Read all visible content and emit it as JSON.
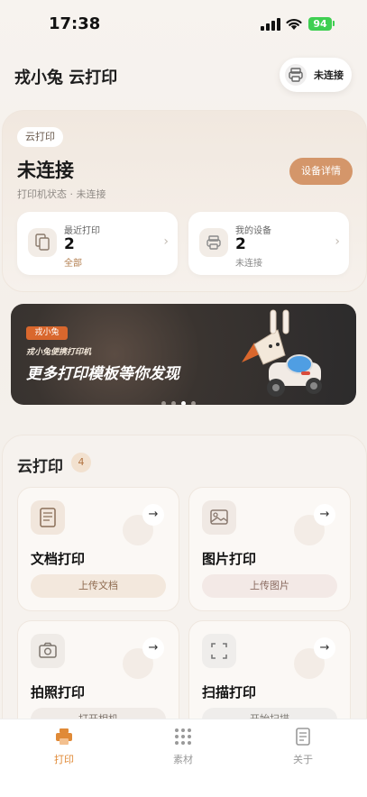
{
  "status_bar": {
    "time": "17:38",
    "battery": "94"
  },
  "header": {
    "title": "戎小兔 云打印",
    "connect_label": "未连接"
  },
  "status_card": {
    "tag": "云打印",
    "title": "未连接",
    "subtitle": "打印机状态 · 未连接",
    "detail_button": "设备详情",
    "recent": {
      "label": "最近打印",
      "value": "2",
      "sub": "全部"
    },
    "devices": {
      "label": "我的设备",
      "value": "2",
      "sub": "未连接"
    }
  },
  "banner": {
    "tag": "戎小兔",
    "small": "戎小兔便携打印机",
    "big": "更多打印模板等你发现",
    "dots": 4,
    "active": 2
  },
  "section": {
    "title": "云打印",
    "count": "4",
    "items": [
      {
        "name": "文档打印",
        "action": "上传文档"
      },
      {
        "name": "图片打印",
        "action": "上传图片"
      },
      {
        "name": "拍照打印",
        "action": "打开相机"
      },
      {
        "name": "扫描打印",
        "action": "开始扫描"
      }
    ]
  },
  "tabbar": {
    "tabs": [
      {
        "label": "打印"
      },
      {
        "label": "素材"
      },
      {
        "label": "关于"
      }
    ],
    "active": 0
  },
  "colors": {
    "accent": "#e08a37",
    "button": "#d4966a",
    "battery": "#3fcf52"
  }
}
